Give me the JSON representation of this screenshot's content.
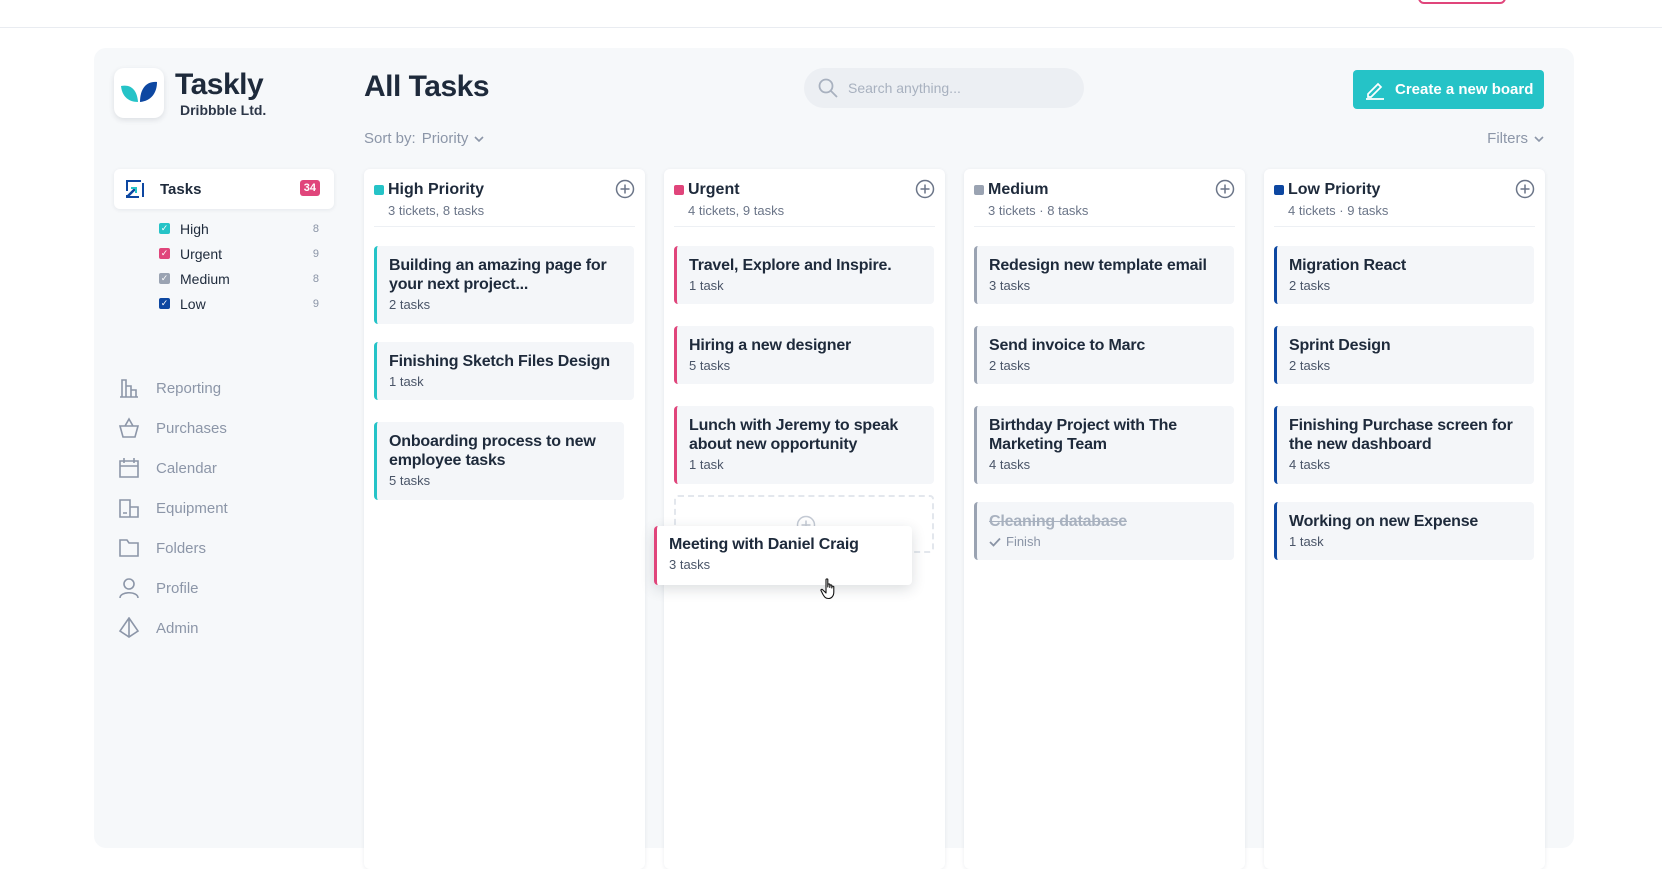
{
  "brand": {
    "name": "Taskly",
    "company": "Dribbble Ltd."
  },
  "header": {
    "title": "All Tasks",
    "search_placeholder": "Search anything...",
    "create_button": "Create a new board",
    "sort_label": "Sort by:",
    "sort_value": "Priority",
    "filters_label": "Filters"
  },
  "sidebar": {
    "tasks": {
      "label": "Tasks",
      "count": "34"
    },
    "filters": [
      {
        "label": "High",
        "count": "8",
        "color": "#25c3c7"
      },
      {
        "label": "Urgent",
        "count": "9",
        "color": "#e0457b"
      },
      {
        "label": "Medium",
        "count": "8",
        "color": "#9aa3b2"
      },
      {
        "label": "Low",
        "count": "9",
        "color": "#0d47a1"
      }
    ],
    "menu": [
      {
        "label": "Reporting",
        "icon": "bar-chart-icon"
      },
      {
        "label": "Purchases",
        "icon": "basket-icon"
      },
      {
        "label": "Calendar",
        "icon": "calendar-icon"
      },
      {
        "label": "Equipment",
        "icon": "equipment-icon"
      },
      {
        "label": "Folders",
        "icon": "folder-icon"
      },
      {
        "label": "Profile",
        "icon": "user-icon"
      },
      {
        "label": "Admin",
        "icon": "admin-icon"
      }
    ]
  },
  "columns": [
    {
      "title": "High Priority",
      "subtitle": "3 tickets, 8 tasks",
      "color": "#25c3c7",
      "cards": [
        {
          "title": "Building an amazing page for your next project...",
          "sub": "2 tasks"
        },
        {
          "title": "Finishing Sketch Files Design",
          "sub": "1 task"
        },
        {
          "title": "Onboarding process to new employee tasks",
          "sub": "5 tasks"
        }
      ]
    },
    {
      "title": "Urgent",
      "subtitle": "4 tickets, 9 tasks",
      "color": "#e0457b",
      "cards": [
        {
          "title": "Travel, Explore and Inspire.",
          "sub": "1 task"
        },
        {
          "title": "Hiring a new designer",
          "sub": "5 tasks"
        },
        {
          "title": "Lunch with Jeremy to speak about new opportunity",
          "sub": "1 task"
        }
      ],
      "dragging": {
        "title": "Meeting with Daniel Craig",
        "sub": "3 tasks"
      }
    },
    {
      "title": "Medium",
      "subtitle": "3 tickets · 8 tasks",
      "color": "#9aa3b2",
      "cards": [
        {
          "title": "Redesign new template email",
          "sub": "3 tasks"
        },
        {
          "title": "Send invoice to Marc",
          "sub": "2 tasks"
        },
        {
          "title": "Birthday Project with The Marketing  Team",
          "sub": "4 tasks"
        },
        {
          "title": "Cleaning database",
          "sub": "Finish"
        }
      ]
    },
    {
      "title": "Low Priority",
      "subtitle": "4 tickets · 9 tasks",
      "color": "#0d47a1",
      "cards": [
        {
          "title": "Migration React",
          "sub": "2 tasks"
        },
        {
          "title": "Sprint Design",
          "sub": "2 tasks"
        },
        {
          "title": "Finishing Purchase screen for the new dashboard",
          "sub": "4 tasks"
        },
        {
          "title": "Working on new Expense",
          "sub": "1 task"
        }
      ]
    }
  ]
}
